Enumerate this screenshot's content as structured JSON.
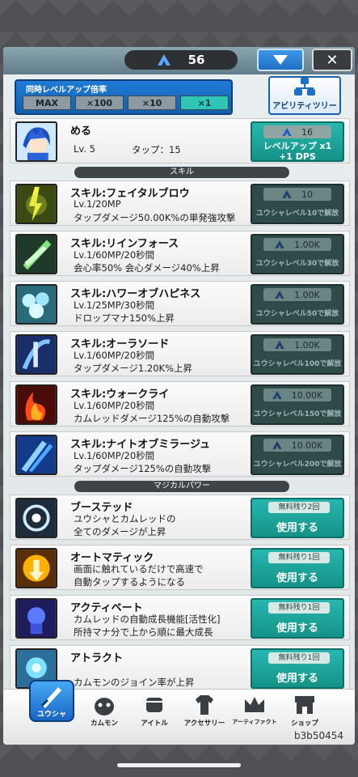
{
  "header": {
    "mana": "56",
    "dropdown_icon": "triangle-down",
    "close_label": "✕"
  },
  "multiplier": {
    "title": "同時レベルアップ倍率",
    "options": [
      "MAX",
      "×100",
      "×10",
      "×1"
    ],
    "selected": "×1"
  },
  "ability_tree": {
    "label": "アビリティツリー"
  },
  "hero": {
    "name": "める",
    "level": "Lv. 5",
    "tap": "タップ：15",
    "cost": "16",
    "button_line1": "レベルアップ x1",
    "button_line2": "+1 DPS"
  },
  "sections": {
    "skills": "スキル",
    "magical_power": "マジカルパワー"
  },
  "skills": [
    {
      "name": "スキル:フェイタルブロウ",
      "stats": "Lv.1/20MP",
      "desc": "タップダメージ50.00K%の単発強攻撃",
      "cost": "10",
      "unlock": "ユウシャレベル10で解放"
    },
    {
      "name": "スキル:リインフォース",
      "stats": "Lv.1/60MP/20秒間",
      "desc": "会心率50% 会心ダメージ40%上昇",
      "cost": "1.00K",
      "unlock": "ユウシャレベル30で解放"
    },
    {
      "name": "スキル:ハワーオブハピネス",
      "stats": "Lv.1/25MP/30秒間",
      "desc": "ドロップマナ150%上昇",
      "cost": "1.00K",
      "unlock": "ユウシャレベル50で解放"
    },
    {
      "name": "スキル:オーラソード",
      "stats": "Lv.1/60MP/20秒間",
      "desc": "タップダメージ1.20K%上昇",
      "cost": "1.00K",
      "unlock": "ユウシャレベル100で解放"
    },
    {
      "name": "スキル:ウォークライ",
      "stats": "Lv.1/60MP/20秒間",
      "desc": "カムレッドダメージ125%の自動攻撃",
      "cost": "10.00K",
      "unlock": "ユウシャレベル150で解放"
    },
    {
      "name": "スキル:ナイトオブミラージュ",
      "stats": "Lv.1/60MP/20秒間",
      "desc": "タップダメージ125%の自動攻撃",
      "cost": "10.00K",
      "unlock": "ユウシャレベル200で解放"
    }
  ],
  "powers": [
    {
      "name": "ブーステッド",
      "line1": "ユウシャとカムレッドの",
      "line2": "全てのダメージが上昇",
      "free": "無料残り2回",
      "use": "使用する"
    },
    {
      "name": "オートマティック",
      "line1": "画面に触れているだけで高速で",
      "line2": "自動タップするようになる",
      "free": "無料残り1回",
      "use": "使用する"
    },
    {
      "name": "アクティベート",
      "line1": "カムレッドの自動成長機能[活性化]",
      "line2": "所持マナ分で上から順に最大成長",
      "free": "無料残り1回",
      "use": "使用する"
    },
    {
      "name": "アトラクト",
      "line1": "",
      "line2": "カムモンのジョイン率が上昇",
      "free": "無料残り1回",
      "use": "使用する"
    }
  ],
  "nav": [
    {
      "label": "ユウシャ",
      "icon": "sword-icon",
      "active": true
    },
    {
      "label": "カムモン",
      "icon": "monster-icon"
    },
    {
      "label": "アイトル",
      "icon": "fist-icon"
    },
    {
      "label": "アクセサリー",
      "icon": "shirt-icon"
    },
    {
      "label": "アーティファクト",
      "icon": "crown-icon"
    },
    {
      "label": "ショップ",
      "icon": "shop-icon"
    }
  ],
  "build_id": "b3b50454",
  "colors": {
    "accent_blue": "#1f6fc4",
    "teal": "#27b7ae",
    "locked": "#2e4b4a"
  }
}
